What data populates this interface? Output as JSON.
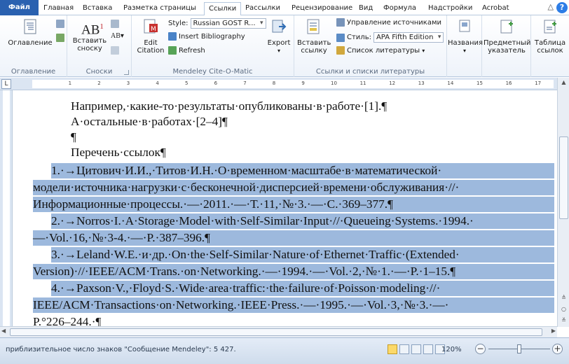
{
  "tabs": [
    "Файл",
    "Главная",
    "Вставка",
    "Разметка страницы",
    "Ссылки",
    "Рассылки",
    "Рецензирование",
    "Вид",
    "Формула",
    "Надстройки",
    "Acrobat"
  ],
  "ribbon": {
    "toc": {
      "button": "Оглавление",
      "group": "Оглавление"
    },
    "footnotes": {
      "insert_label": "Вставить\nсноску",
      "button_icon_text": "AB",
      "group": "Сноски"
    },
    "mendeley": {
      "style_label": "Style:",
      "style_value": "Russian GOST R...",
      "insert_bibliography": "Insert Bibliography",
      "refresh": "Refresh",
      "edit_citation": "Edit\nCitation",
      "export": "Export",
      "group": "Mendeley Cite-O-Matic"
    },
    "citations": {
      "insert_ref": "Вставить\nссылку",
      "manage_sources": "Управление источниками",
      "style_label": "Стиль:",
      "style_value": "APA Fifth Edition",
      "bibliography": "Список литературы",
      "group": "Ссылки и списки литературы"
    },
    "captions": {
      "button": "Названия"
    },
    "index": {
      "button": "Предметный\nуказатель"
    },
    "toa": {
      "button": "Таблица\nссылок"
    }
  },
  "document": {
    "lines": [
      {
        "text": "Например,·какие-то·результаты·опубликованы·в·работе·[1].¶",
        "hl": false
      },
      {
        "text": "А·остальные·в·работах·[2–4]¶",
        "hl": false
      },
      {
        "text": "¶",
        "hl": false
      },
      {
        "text": "Перечень·ссылок¶",
        "hl": false
      },
      {
        "text": "1.·→Цитович·И.И.,·Титов·И.Н.·О·временном·масштабе·в·математической·",
        "hl": true
      },
      {
        "text": "модели·источника·нагрузки·с·бесконечной·дисперсией·времени·обслуживания·//·",
        "hl": true
      },
      {
        "text": "Информационные·процессы.·—·2011.·—·Т.·11,·№·3.·—·С.·369–377.¶",
        "hl": true
      },
      {
        "text": "2.·→Norros·I.·A·Storage·Model·with·Self-Similar·Input·//·Queueing·Systems.·1994.·",
        "hl": true
      },
      {
        "text": "—·Vol.·16,·№·3-4.·—·P.·387–396.¶",
        "hl": true
      },
      {
        "text": "3.·→Leland·W.E.·и·др.·On·the·Self-Similar·Nature·of·Ethernet·Traffic·(Extended·",
        "hl": true
      },
      {
        "text": "Version)·//·IEEE/ACM·Trans.·on·Networking.·—·1994.·—·Vol.·2,·№·1.·—·P.·1–15.¶",
        "hl": true
      },
      {
        "text": "4.·→Paxson·V.,·Floyd·S.·Wide·area·traffic:·the·failure·of·Poisson·modeling·//·",
        "hl": true
      },
      {
        "text": "IEEE/ACM·Transactions·on·Networking.·IEEE·Press.·—·1995.·—·Vol.·3,·№·3.·—·",
        "hl": true
      },
      {
        "text": "P.°226–244.·¶",
        "hl": false
      }
    ]
  },
  "status": {
    "text": "приблизительное число знаков \"Сообщение Mendeley\": 5 427.",
    "zoom": "120%"
  }
}
